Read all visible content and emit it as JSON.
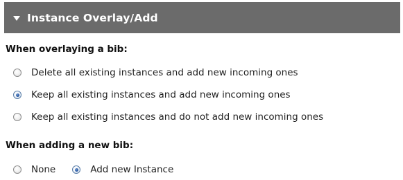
{
  "panel": {
    "title": "Instance Overlay/Add",
    "toggle_icon": "triangle-down-icon",
    "header_color": "#6b6b6b"
  },
  "overlay_section": {
    "label": "When overlaying a bib:",
    "options": [
      {
        "label": "Delete all existing instances and add new incoming ones",
        "selected": false
      },
      {
        "label": "Keep all existing instances and add new incoming ones",
        "selected": true
      },
      {
        "label": "Keep all existing instances and do not add new incoming ones",
        "selected": false
      }
    ]
  },
  "add_section": {
    "label": "When adding a new bib:",
    "options": [
      {
        "label": "None",
        "selected": false
      },
      {
        "label": "Add new Instance",
        "selected": true
      }
    ]
  }
}
